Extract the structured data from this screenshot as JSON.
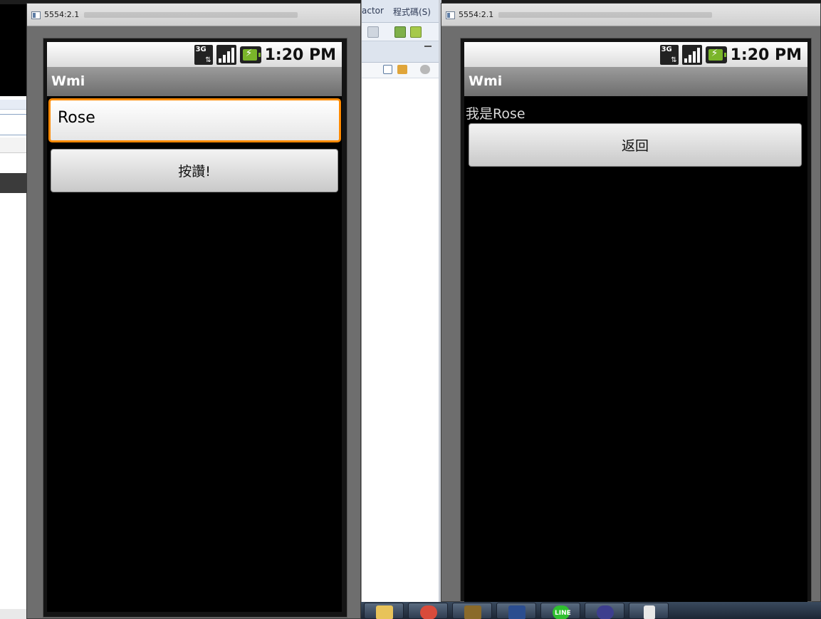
{
  "ide": {
    "menu_items": [
      "actor",
      "程式碼(S)"
    ]
  },
  "emulators": [
    {
      "window_title": "5554:2.1",
      "status": {
        "network": "3G",
        "clock": "1:20 PM"
      },
      "app_title": "Wmi",
      "input_value": "Rose",
      "button_label": "按讚!"
    },
    {
      "window_title": "5554:2.1",
      "status": {
        "network": "3G",
        "clock": "1:20 PM"
      },
      "app_title": "Wmi",
      "greeting": "我是Rose",
      "button_label": "返回"
    }
  ],
  "taskbar": {
    "items": [
      {
        "icon": "folder-icon",
        "color": "#e8c35a"
      },
      {
        "icon": "chrome-icon",
        "color": "#d94b3b"
      },
      {
        "icon": "game-icon",
        "color": "#8a6a2a"
      },
      {
        "icon": "league-icon",
        "color": "#2b4d8f"
      },
      {
        "icon": "line-icon",
        "color": "#2fbf2f",
        "label": "LINE"
      },
      {
        "icon": "eclipse-icon",
        "color": "#3d3e8e"
      },
      {
        "icon": "document-icon",
        "color": "#e8e8e8"
      }
    ]
  },
  "colors": {
    "focus_orange": "#ff8a00",
    "battery_green": "#7ab52a",
    "screen_bg": "#000000"
  }
}
